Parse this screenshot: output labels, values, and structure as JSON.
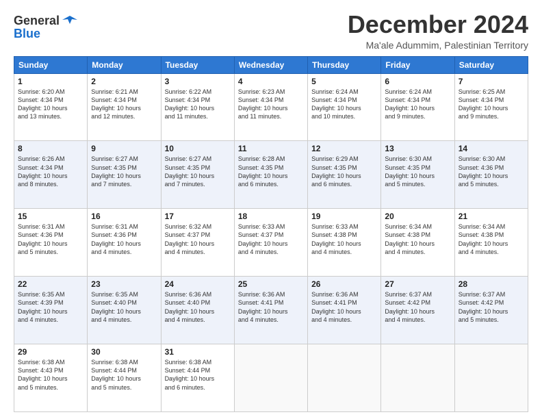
{
  "header": {
    "logo_general": "General",
    "logo_blue": "Blue",
    "month_title": "December 2024",
    "subtitle": "Ma'ale Adummim, Palestinian Territory"
  },
  "days_of_week": [
    "Sunday",
    "Monday",
    "Tuesday",
    "Wednesday",
    "Thursday",
    "Friday",
    "Saturday"
  ],
  "weeks": [
    [
      {
        "day": "1",
        "lines": [
          "Sunrise: 6:20 AM",
          "Sunset: 4:34 PM",
          "Daylight: 10 hours",
          "and 13 minutes."
        ]
      },
      {
        "day": "2",
        "lines": [
          "Sunrise: 6:21 AM",
          "Sunset: 4:34 PM",
          "Daylight: 10 hours",
          "and 12 minutes."
        ]
      },
      {
        "day": "3",
        "lines": [
          "Sunrise: 6:22 AM",
          "Sunset: 4:34 PM",
          "Daylight: 10 hours",
          "and 11 minutes."
        ]
      },
      {
        "day": "4",
        "lines": [
          "Sunrise: 6:23 AM",
          "Sunset: 4:34 PM",
          "Daylight: 10 hours",
          "and 11 minutes."
        ]
      },
      {
        "day": "5",
        "lines": [
          "Sunrise: 6:24 AM",
          "Sunset: 4:34 PM",
          "Daylight: 10 hours",
          "and 10 minutes."
        ]
      },
      {
        "day": "6",
        "lines": [
          "Sunrise: 6:24 AM",
          "Sunset: 4:34 PM",
          "Daylight: 10 hours",
          "and 9 minutes."
        ]
      },
      {
        "day": "7",
        "lines": [
          "Sunrise: 6:25 AM",
          "Sunset: 4:34 PM",
          "Daylight: 10 hours",
          "and 9 minutes."
        ]
      }
    ],
    [
      {
        "day": "8",
        "lines": [
          "Sunrise: 6:26 AM",
          "Sunset: 4:34 PM",
          "Daylight: 10 hours",
          "and 8 minutes."
        ]
      },
      {
        "day": "9",
        "lines": [
          "Sunrise: 6:27 AM",
          "Sunset: 4:35 PM",
          "Daylight: 10 hours",
          "and 7 minutes."
        ]
      },
      {
        "day": "10",
        "lines": [
          "Sunrise: 6:27 AM",
          "Sunset: 4:35 PM",
          "Daylight: 10 hours",
          "and 7 minutes."
        ]
      },
      {
        "day": "11",
        "lines": [
          "Sunrise: 6:28 AM",
          "Sunset: 4:35 PM",
          "Daylight: 10 hours",
          "and 6 minutes."
        ]
      },
      {
        "day": "12",
        "lines": [
          "Sunrise: 6:29 AM",
          "Sunset: 4:35 PM",
          "Daylight: 10 hours",
          "and 6 minutes."
        ]
      },
      {
        "day": "13",
        "lines": [
          "Sunrise: 6:30 AM",
          "Sunset: 4:35 PM",
          "Daylight: 10 hours",
          "and 5 minutes."
        ]
      },
      {
        "day": "14",
        "lines": [
          "Sunrise: 6:30 AM",
          "Sunset: 4:36 PM",
          "Daylight: 10 hours",
          "and 5 minutes."
        ]
      }
    ],
    [
      {
        "day": "15",
        "lines": [
          "Sunrise: 6:31 AM",
          "Sunset: 4:36 PM",
          "Daylight: 10 hours",
          "and 5 minutes."
        ]
      },
      {
        "day": "16",
        "lines": [
          "Sunrise: 6:31 AM",
          "Sunset: 4:36 PM",
          "Daylight: 10 hours",
          "and 4 minutes."
        ]
      },
      {
        "day": "17",
        "lines": [
          "Sunrise: 6:32 AM",
          "Sunset: 4:37 PM",
          "Daylight: 10 hours",
          "and 4 minutes."
        ]
      },
      {
        "day": "18",
        "lines": [
          "Sunrise: 6:33 AM",
          "Sunset: 4:37 PM",
          "Daylight: 10 hours",
          "and 4 minutes."
        ]
      },
      {
        "day": "19",
        "lines": [
          "Sunrise: 6:33 AM",
          "Sunset: 4:38 PM",
          "Daylight: 10 hours",
          "and 4 minutes."
        ]
      },
      {
        "day": "20",
        "lines": [
          "Sunrise: 6:34 AM",
          "Sunset: 4:38 PM",
          "Daylight: 10 hours",
          "and 4 minutes."
        ]
      },
      {
        "day": "21",
        "lines": [
          "Sunrise: 6:34 AM",
          "Sunset: 4:38 PM",
          "Daylight: 10 hours",
          "and 4 minutes."
        ]
      }
    ],
    [
      {
        "day": "22",
        "lines": [
          "Sunrise: 6:35 AM",
          "Sunset: 4:39 PM",
          "Daylight: 10 hours",
          "and 4 minutes."
        ]
      },
      {
        "day": "23",
        "lines": [
          "Sunrise: 6:35 AM",
          "Sunset: 4:40 PM",
          "Daylight: 10 hours",
          "and 4 minutes."
        ]
      },
      {
        "day": "24",
        "lines": [
          "Sunrise: 6:36 AM",
          "Sunset: 4:40 PM",
          "Daylight: 10 hours",
          "and 4 minutes."
        ]
      },
      {
        "day": "25",
        "lines": [
          "Sunrise: 6:36 AM",
          "Sunset: 4:41 PM",
          "Daylight: 10 hours",
          "and 4 minutes."
        ]
      },
      {
        "day": "26",
        "lines": [
          "Sunrise: 6:36 AM",
          "Sunset: 4:41 PM",
          "Daylight: 10 hours",
          "and 4 minutes."
        ]
      },
      {
        "day": "27",
        "lines": [
          "Sunrise: 6:37 AM",
          "Sunset: 4:42 PM",
          "Daylight: 10 hours",
          "and 4 minutes."
        ]
      },
      {
        "day": "28",
        "lines": [
          "Sunrise: 6:37 AM",
          "Sunset: 4:42 PM",
          "Daylight: 10 hours",
          "and 5 minutes."
        ]
      }
    ],
    [
      {
        "day": "29",
        "lines": [
          "Sunrise: 6:38 AM",
          "Sunset: 4:43 PM",
          "Daylight: 10 hours",
          "and 5 minutes."
        ]
      },
      {
        "day": "30",
        "lines": [
          "Sunrise: 6:38 AM",
          "Sunset: 4:44 PM",
          "Daylight: 10 hours",
          "and 5 minutes."
        ]
      },
      {
        "day": "31",
        "lines": [
          "Sunrise: 6:38 AM",
          "Sunset: 4:44 PM",
          "Daylight: 10 hours",
          "and 6 minutes."
        ]
      },
      null,
      null,
      null,
      null
    ]
  ]
}
